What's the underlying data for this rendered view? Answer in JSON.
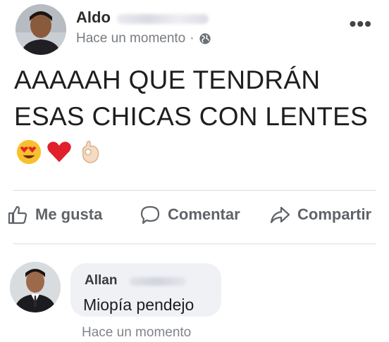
{
  "post": {
    "author_name": "Aldo",
    "timestamp": "Hace un momento",
    "separator": "·",
    "privacy_icon": "globe-icon",
    "more_label": "•••",
    "text_line1": "AAAAAH QUE TENDRÁN",
    "text_line2": "ESAS CHICAS CON LENTES",
    "emojis": [
      "heart-eyes-emoji",
      "red-heart-emoji",
      "ok-hand-emoji"
    ]
  },
  "actions": {
    "like_label": "Me gusta",
    "comment_label": "Comentar",
    "share_label": "Compartir"
  },
  "comment": {
    "author_name": "Allan",
    "text": "Miopía pendejo",
    "timestamp": "Hace un momento"
  },
  "colors": {
    "action_gray": "#5f6368",
    "divider": "#dadde1",
    "bubble": "#eff1f5",
    "heart_red": "#e0202b"
  }
}
